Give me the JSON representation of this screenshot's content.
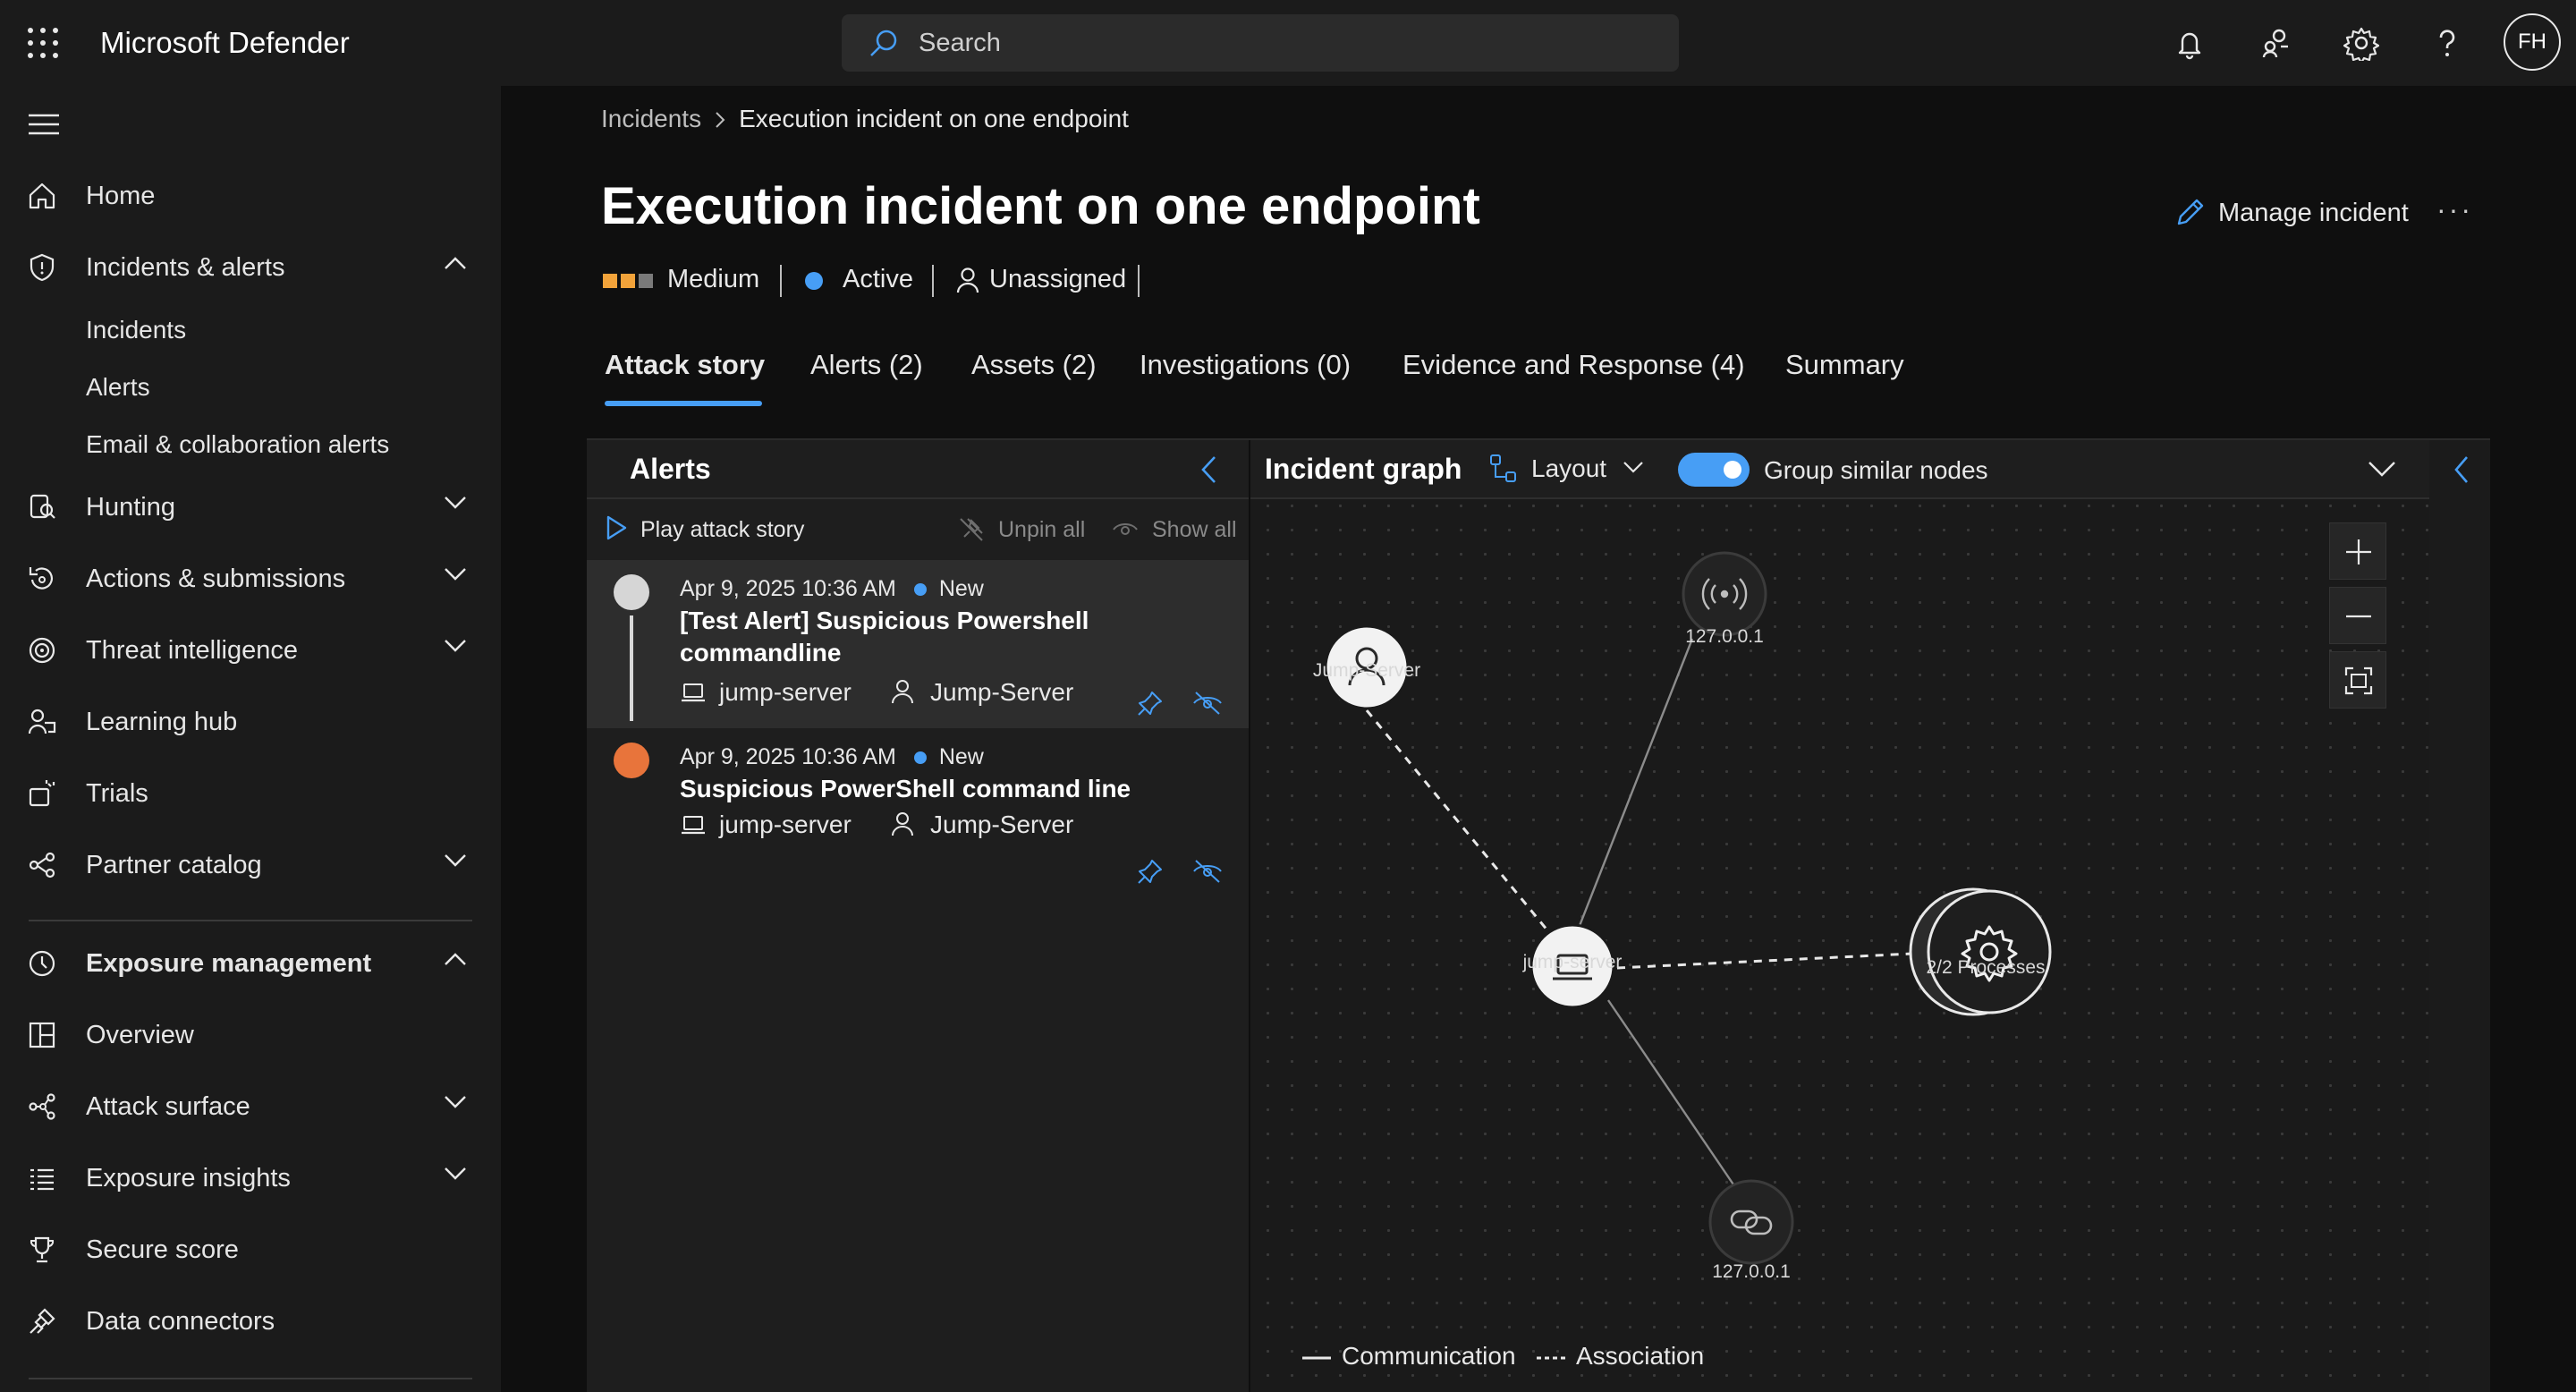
{
  "app": {
    "title": "Microsoft Defender"
  },
  "search": {
    "placeholder": "Search"
  },
  "user": {
    "initials": "FH"
  },
  "topbar_icons": [
    "bell-icon",
    "community-icon",
    "gear-icon",
    "help-icon"
  ],
  "sidebar": {
    "items": [
      {
        "label": "Home",
        "icon": "home-icon"
      },
      {
        "label": "Incidents & alerts",
        "icon": "shield-icon",
        "expanded": true,
        "children": [
          "Incidents",
          "Alerts",
          "Email & collaboration alerts"
        ]
      },
      {
        "label": "Hunting",
        "icon": "hunting-icon"
      },
      {
        "label": "Actions & submissions",
        "icon": "actions-icon"
      },
      {
        "label": "Threat intelligence",
        "icon": "threat-intel-icon"
      },
      {
        "label": "Learning hub",
        "icon": "learning-icon"
      },
      {
        "label": "Trials",
        "icon": "trials-icon"
      },
      {
        "label": "Partner catalog",
        "icon": "partner-icon"
      },
      {
        "label": "Exposure management",
        "icon": "exposure-icon",
        "expanded": true
      },
      {
        "label": "Overview",
        "icon": "overview-icon"
      },
      {
        "label": "Attack surface",
        "icon": "attack-surface-icon"
      },
      {
        "label": "Exposure insights",
        "icon": "insights-icon"
      },
      {
        "label": "Secure score",
        "icon": "trophy-icon"
      },
      {
        "label": "Data connectors",
        "icon": "connector-icon"
      }
    ]
  },
  "breadcrumb": {
    "parent": "Incidents",
    "separator": ">",
    "current": "Execution incident on one endpoint"
  },
  "incident": {
    "title": "Execution incident on one endpoint",
    "severity": "Medium",
    "status": "Active",
    "assignee": "Unassigned",
    "manage_label": "Manage incident",
    "more_label": "···"
  },
  "tabs": [
    {
      "label": "Attack story",
      "active": true
    },
    {
      "label": "Alerts (2)"
    },
    {
      "label": "Assets (2)"
    },
    {
      "label": "Investigations (0)"
    },
    {
      "label": "Evidence and Response (4)"
    },
    {
      "label": "Summary"
    }
  ],
  "alerts_panel": {
    "title": "Alerts",
    "play_label": "Play attack story",
    "unpin_label": "Unpin all",
    "show_label": "Show all",
    "alerts": [
      {
        "datetime": "Apr 9, 2025 10:36 AM",
        "status": "New",
        "title": "[Test Alert] Suspicious Powershell commandline",
        "device": "jump-server",
        "user": "Jump-Server",
        "severity_color": "#d6d6d6"
      },
      {
        "datetime": "Apr 9, 2025 10:36 AM",
        "status": "New",
        "title": "Suspicious PowerShell command line",
        "device": "jump-server",
        "user": "Jump-Server",
        "severity_color": "#e8743b"
      }
    ]
  },
  "graph": {
    "title": "Incident graph",
    "layout_label": "Layout",
    "group_label": "Group similar nodes",
    "group_enabled": true,
    "nodes": [
      {
        "id": "user",
        "label": "Jump-Server",
        "icon": "user-icon"
      },
      {
        "id": "ip1",
        "label": "127.0.0.1",
        "icon": "broadcast-icon"
      },
      {
        "id": "device",
        "label": "jump-server",
        "icon": "laptop-icon"
      },
      {
        "id": "proc",
        "label": "2/2 Processes",
        "icon": "gear-icon"
      },
      {
        "id": "ip2",
        "label": "127.0.0.1",
        "icon": "link-icon"
      }
    ],
    "edges": [
      {
        "from": "user",
        "to": "device",
        "type": "Association"
      },
      {
        "from": "ip1",
        "to": "device",
        "type": "Communication"
      },
      {
        "from": "device",
        "to": "proc",
        "type": "Association"
      },
      {
        "from": "device",
        "to": "ip2",
        "type": "Communication"
      }
    ],
    "legend": {
      "communication": "Communication",
      "association": "Association"
    }
  },
  "colors": {
    "accent": "#479ef5",
    "severity_medium": "#f2a33a",
    "status_active": "#479ef5"
  }
}
